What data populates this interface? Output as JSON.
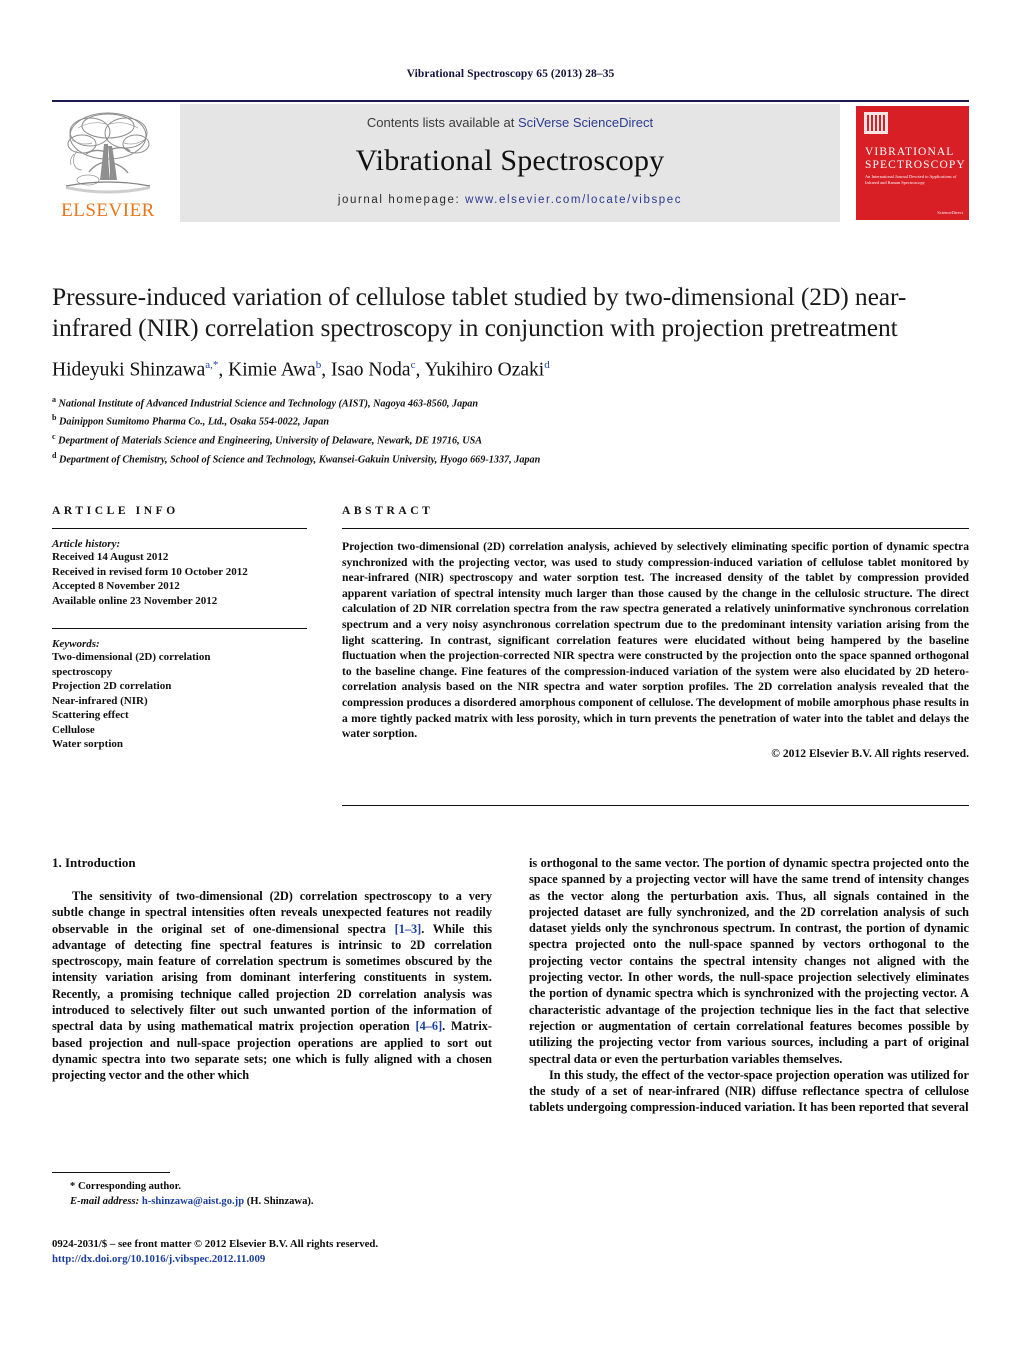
{
  "running_head": "Vibrational Spectroscopy 65 (2013) 28–35",
  "header": {
    "contents_prefix": "Contents lists available at ",
    "contents_link": "SciVerse ScienceDirect",
    "journal_title": "Vibrational Spectroscopy",
    "homepage_prefix": "journal homepage: ",
    "homepage_url": "www.elsevier.com/locate/vibspec",
    "publisher_name": "ELSEVIER",
    "cover": {
      "title_line1": "VIBRATIONAL",
      "title_line2": "SPECTROSCOPY",
      "subtitle": "An International Journal Devoted to Applications of Infrared and Raman Spectroscopy",
      "footer": "ScienceDirect"
    }
  },
  "article": {
    "title": "Pressure-induced variation of cellulose tablet studied by two-dimensional (2D) near-infrared (NIR) correlation spectroscopy in conjunction with projection pretreatment",
    "authors": [
      {
        "name": "Hideyuki Shinzawa",
        "marks": "a,*"
      },
      {
        "name": "Kimie Awa",
        "marks": "b"
      },
      {
        "name": "Isao Noda",
        "marks": "c"
      },
      {
        "name": "Yukihiro Ozaki",
        "marks": "d"
      }
    ],
    "affiliations": [
      {
        "mark": "a",
        "text": "National Institute of Advanced Industrial Science and Technology (AIST), Nagoya 463-8560, Japan"
      },
      {
        "mark": "b",
        "text": "Dainippon Sumitomo Pharma Co., Ltd., Osaka 554-0022, Japan"
      },
      {
        "mark": "c",
        "text": "Department of Materials Science and Engineering, University of Delaware, Newark, DE 19716, USA"
      },
      {
        "mark": "d",
        "text": "Department of Chemistry, School of Science and Technology, Kwansei-Gakuin University, Hyogo 669-1337, Japan"
      }
    ]
  },
  "article_info": {
    "label": "ARTICLE INFO",
    "history_label": "Article history:",
    "history": [
      "Received 14 August 2012",
      "Received in revised form 10 October 2012",
      "Accepted 8 November 2012",
      "Available online 23 November 2012"
    ],
    "keywords_label": "Keywords:",
    "keywords": [
      "Two-dimensional (2D) correlation",
      "spectroscopy",
      "Projection 2D correlation",
      "Near-infrared (NIR)",
      "Scattering effect",
      "Cellulose",
      "Water sorption"
    ]
  },
  "abstract": {
    "label": "ABSTRACT",
    "text": "Projection two-dimensional (2D) correlation analysis, achieved by selectively eliminating specific portion of dynamic spectra synchronized with the projecting vector, was used to study compression-induced variation of cellulose tablet monitored by near-infrared (NIR) spectroscopy and water sorption test. The increased density of the tablet by compression provided apparent variation of spectral intensity much larger than those caused by the change in the cellulosic structure. The direct calculation of 2D NIR correlation spectra from the raw spectra generated a relatively uninformative synchronous correlation spectrum and a very noisy asynchronous correlation spectrum due to the predominant intensity variation arising from the light scattering. In contrast, significant correlation features were elucidated without being hampered by the baseline fluctuation when the projection-corrected NIR spectra were constructed by the projection onto the space spanned orthogonal to the baseline change. Fine features of the compression-induced variation of the system were also elucidated by 2D hetero-correlation analysis based on the NIR spectra and water sorption profiles. The 2D correlation analysis revealed that the compression produces a disordered amorphous component of cellulose. The development of mobile amorphous phase results in a more tightly packed matrix with less porosity, which in turn prevents the penetration of water into the tablet and delays the water sorption.",
    "copyright": "© 2012 Elsevier B.V. All rights reserved."
  },
  "introduction": {
    "heading": "1. Introduction",
    "left_para_1_a": "The sensitivity of two-dimensional (2D) correlation spectroscopy to a very subtle change in spectral intensities often reveals unexpected features not readily observable in the original set of one-dimensional spectra ",
    "left_cite_1": "[1–3]",
    "left_para_1_b": ". While this advantage of detecting fine spectral features is intrinsic to 2D correlation spectroscopy, main feature of correlation spectrum is sometimes obscured by the intensity variation arising from dominant interfering constituents in system. Recently, a promising technique called projection 2D correlation analysis was introduced to selectively filter out such unwanted portion of the information of spectral data by using mathematical matrix projection operation ",
    "left_cite_2": "[4–6]",
    "left_para_1_c": ". Matrix-based projection and null-space projection operations are applied to sort out dynamic spectra into two separate sets; one which is fully aligned with a chosen projecting vector and the other which",
    "right_para_1": "is orthogonal to the same vector. The portion of dynamic spectra projected onto the space spanned by a projecting vector will have the same trend of intensity changes as the vector along the perturbation axis. Thus, all signals contained in the projected dataset are fully synchronized, and the 2D correlation analysis of such dataset yields only the synchronous spectrum. In contrast, the portion of dynamic spectra projected onto the null-space spanned by vectors orthogonal to the projecting vector contains the spectral intensity changes not aligned with the projecting vector. In other words, the null-space projection selectively eliminates the portion of dynamic spectra which is synchronized with the projecting vector. A characteristic advantage of the projection technique lies in the fact that selective rejection or augmentation of certain correlational features becomes possible by utilizing the projecting vector from various sources, including a part of original spectral data or even the perturbation variables themselves.",
    "right_para_2": "In this study, the effect of the vector-space projection operation was utilized for the study of a set of near-infrared (NIR) diffuse reflectance spectra of cellulose tablets undergoing compression-induced variation. It has been reported that several"
  },
  "footnote": {
    "corresponding": "* Corresponding author.",
    "email_label": "E-mail address:",
    "email": "h-shinzawa@aist.go.jp",
    "email_suffix": " (H. Shinzawa)."
  },
  "imprint": {
    "line1": "0924-2031/$ – see front matter © 2012 Elsevier B.V. All rights reserved.",
    "doi": "http://dx.doi.org/10.1016/j.vibspec.2012.11.009"
  },
  "colors": {
    "link": "#1a3fa0",
    "header_rule": "#1b1b52",
    "band_bg": "#e5e5e5",
    "cover_red": "#d81f26",
    "elsevier_orange": "#e8761a"
  }
}
